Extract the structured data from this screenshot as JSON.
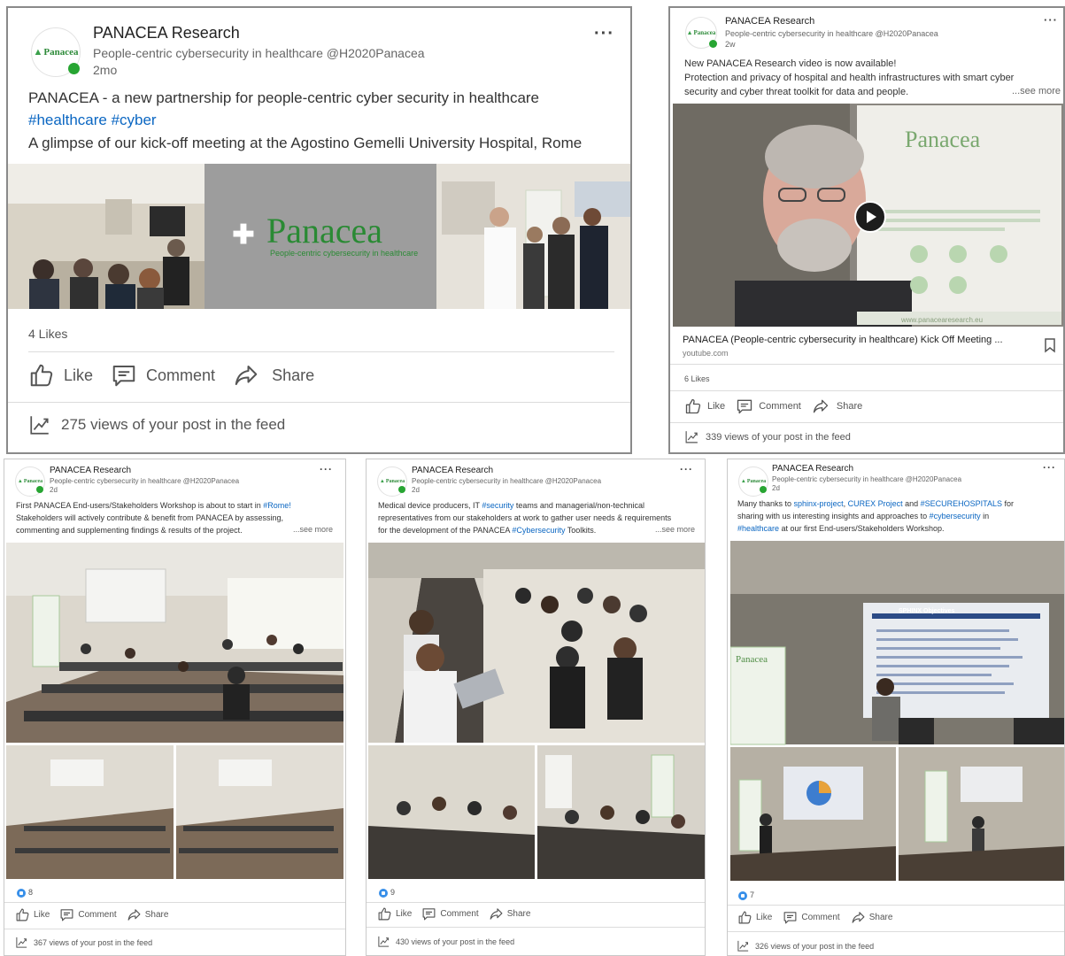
{
  "posts": [
    {
      "author": "PANACEA Research",
      "tagline": "People-centric cybersecurity in healthcare @H2020Panacea",
      "ago": "2mo",
      "logo_text": "Panacea",
      "text_line1": "PANACEA - a new partnership for people-centric cyber security in healthcare",
      "hashtags": "#healthcare #cyber",
      "text_line2": "A glimpse of our kick-off meeting at the Agostino Gemelli University Hospital, Rome",
      "banner_title": "Panacea",
      "banner_sub": "People-centric cybersecurity in healthcare",
      "likes": "4 Likes",
      "like_label": "Like",
      "comment_label": "Comment",
      "share_label": "Share",
      "views": "275 views of your post in the feed"
    },
    {
      "author": "PANACEA Research",
      "tagline": "People-centric cybersecurity in healthcare @H2020Panacea",
      "ago": "2w",
      "logo_text": "Panacea",
      "text_line1": "New PANACEA Research video is now available!",
      "text_line2": "Protection and privacy of hospital and health infrastructures with smart cyber",
      "text_line3": "security and cyber threat toolkit for data and people.",
      "see_more": "...see more",
      "video_title": "PANACEA (People-centric cybersecurity in healthcare) Kick Off Meeting ...",
      "video_source": "youtube.com",
      "poster_title": "Panacea",
      "poster_url": "www.panacearesearch.eu",
      "likes": "6 Likes",
      "like_label": "Like",
      "comment_label": "Comment",
      "share_label": "Share",
      "views": "339 views of your post in the feed"
    },
    {
      "author": "PANACEA Research",
      "tagline": "People-centric cybersecurity in healthcare @H2020Panacea",
      "ago": "2d",
      "logo_text": "Panacea",
      "text_line1_a": "First PANACEA End-users/Stakeholders Workshop is about to start in ",
      "text_line1_tag": "#Rome!",
      "text_line2": "Stakeholders will actively contribute & benefit from PANACEA by assessing,",
      "text_line3": "commenting and supplementing findings & results of the project.",
      "see_more": "...see more",
      "reactions": "8",
      "like_label": "Like",
      "comment_label": "Comment",
      "share_label": "Share",
      "views": "367 views of your post in the feed"
    },
    {
      "author": "PANACEA Research",
      "tagline": "People-centric cybersecurity in healthcare @H2020Panacea",
      "ago": "2d",
      "logo_text": "Panacea",
      "text_line1_a": "Medical device producers, IT ",
      "text_line1_tag": "#security",
      "text_line1_b": " teams and managerial/non-technical",
      "text_line2": "representatives from our stakeholders at work to gather user needs & requirements",
      "text_line3_a": "for the development of the PANACEA ",
      "text_line3_tag": "#Cybersecurity",
      "text_line3_b": " Toolkits.",
      "see_more": "...see more",
      "reactions": "9",
      "like_label": "Like",
      "comment_label": "Comment",
      "share_label": "Share",
      "views": "430 views of your post in the feed"
    },
    {
      "author": "PANACEA Research",
      "tagline": "People-centric cybersecurity in healthcare @H2020Panacea",
      "ago": "2d",
      "logo_text": "Panacea",
      "text_line1_a": "Many thanks to ",
      "text_line1_t1": "sphinx-project",
      "text_line1_sep": ", ",
      "text_line1_t2": "CUREX Project",
      "text_line1_and": " and ",
      "text_line1_t3": "#SECUREHOSPITALS",
      "text_line1_b": " for",
      "text_line2_a": "sharing with us interesting insights and approaches to ",
      "text_line2_tag": "#cybersecurity",
      "text_line2_b": " in",
      "text_line3_tag": "#healthcare",
      "text_line3_b": " at our first End-users/Stakeholders Workshop.",
      "slide_title": "SPHINX Objectives",
      "poster_title": "Panacea",
      "reactions": "7",
      "like_label": "Like",
      "comment_label": "Comment",
      "share_label": "Share",
      "views": "326 views of your post in the feed"
    }
  ],
  "colors": {
    "link": "#0a66c2",
    "online": "#27a532",
    "brand_green": "#2e8b3a"
  },
  "icons": [
    "more-icon",
    "like-icon",
    "comment-icon",
    "share-icon",
    "analytics-icon",
    "play-icon",
    "bookmark-icon",
    "reaction-icon"
  ]
}
